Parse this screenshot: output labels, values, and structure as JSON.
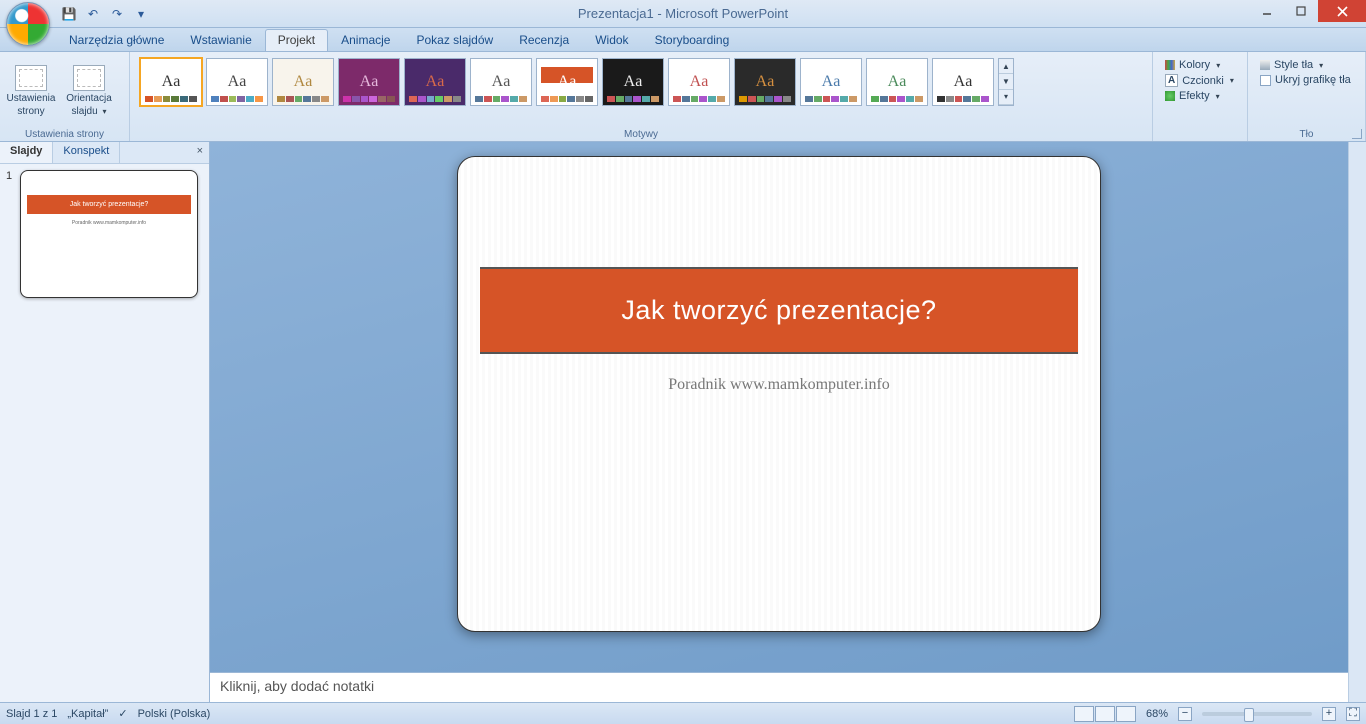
{
  "title": "Prezentacja1 - Microsoft PowerPoint",
  "qat": {
    "save": "💾",
    "undo": "↶",
    "redo": "↷"
  },
  "tabs": [
    "Narzędzia główne",
    "Wstawianie",
    "Projekt",
    "Animacje",
    "Pokaz slajdów",
    "Recenzja",
    "Widok",
    "Storyboarding"
  ],
  "active_tab_index": 2,
  "ribbon": {
    "page_setup": {
      "btn1_l1": "Ustawienia",
      "btn1_l2": "strony",
      "btn2_l1": "Orientacja",
      "btn2_l2": "slajdu",
      "group": "Ustawienia strony"
    },
    "themes_group": "Motywy",
    "colors": "Kolory",
    "fonts": "Czcionki",
    "effects": "Efekty",
    "bg_styles": "Style tła",
    "hide_gfx": "Ukryj grafikę tła",
    "bg_group": "Tło"
  },
  "themes": [
    {
      "bg": "#ffffff",
      "fg": "#d65427",
      "aa": "#333",
      "sel": true,
      "sw": [
        "#d65427",
        "#e89b54",
        "#8b8b3a",
        "#5a7a3a",
        "#3a6a7a",
        "#555"
      ]
    },
    {
      "bg": "#ffffff",
      "fg": "#ffffff",
      "aa": "#444",
      "sw": [
        "#4f81bd",
        "#c0504d",
        "#9bbb59",
        "#8064a2",
        "#4bacc6",
        "#f79646"
      ]
    },
    {
      "bg": "#f8f4ec",
      "fg": "#f8f4ec",
      "aa": "#b08840",
      "sw": [
        "#b08840",
        "#a55",
        "#6a6",
        "#579",
        "#888",
        "#c96"
      ]
    },
    {
      "bg": "#7d2a6a",
      "fg": "#7d2a6a",
      "aa": "#e6b9dd",
      "sw": [
        "#c3a",
        "#85a",
        "#a5c",
        "#c6d",
        "#966",
        "#855"
      ]
    },
    {
      "bg": "#4a2a6a",
      "fg": "#4a2a6a",
      "aa": "#d96a4a",
      "sw": [
        "#d65",
        "#a5c",
        "#7ac",
        "#6c6",
        "#c96",
        "#888"
      ]
    },
    {
      "bg": "#ffffff",
      "fg": "#ffffff",
      "aa": "#555",
      "sw": [
        "#579",
        "#c55",
        "#6a6",
        "#a5c",
        "#5aa",
        "#c96"
      ]
    },
    {
      "bg": "#ffffff",
      "fg": "#d65427",
      "aa": "#fff",
      "band": "#d65427",
      "sw": [
        "#d65",
        "#e95",
        "#8a4",
        "#579",
        "#888",
        "#666"
      ]
    },
    {
      "bg": "#1a1a1a",
      "fg": "#1a1a1a",
      "aa": "#eee",
      "sw": [
        "#c55",
        "#6a6",
        "#579",
        "#a5c",
        "#5aa",
        "#c96"
      ]
    },
    {
      "bg": "#ffffff",
      "fg": "#ffffff",
      "aa": "#c05050",
      "sw": [
        "#c55",
        "#579",
        "#6a6",
        "#a5c",
        "#5aa",
        "#c96"
      ]
    },
    {
      "bg": "#2a2a2a",
      "fg": "#2a2a2a",
      "aa": "#d69040",
      "sw": [
        "#d90",
        "#c55",
        "#6a6",
        "#579",
        "#a5c",
        "#888"
      ]
    },
    {
      "bg": "#ffffff",
      "fg": "#ffffff",
      "aa": "#4a7aaa",
      "sw": [
        "#579",
        "#6a6",
        "#c55",
        "#a5c",
        "#5aa",
        "#c96"
      ]
    },
    {
      "bg": "#ffffff",
      "fg": "#ffffff",
      "aa": "#4a8a5a",
      "sw": [
        "#5a5",
        "#579",
        "#c55",
        "#a5c",
        "#5aa",
        "#c96"
      ]
    },
    {
      "bg": "#ffffff",
      "fg": "#ffffff",
      "aa": "#333",
      "sw": [
        "#333",
        "#888",
        "#c55",
        "#579",
        "#6a6",
        "#a5c"
      ]
    }
  ],
  "side": {
    "tab1": "Slajdy",
    "tab2": "Konspekt"
  },
  "slide": {
    "num": "1",
    "title": "Jak tworzyć prezentacje?",
    "subtitle": "Poradnik www.mamkomputer.info"
  },
  "notes_placeholder": "Kliknij, aby dodać notatki",
  "status": {
    "slide": "Slajd 1 z 1",
    "theme": "„Kapitał”",
    "lang": "Polski (Polska)",
    "zoom": "68%"
  }
}
